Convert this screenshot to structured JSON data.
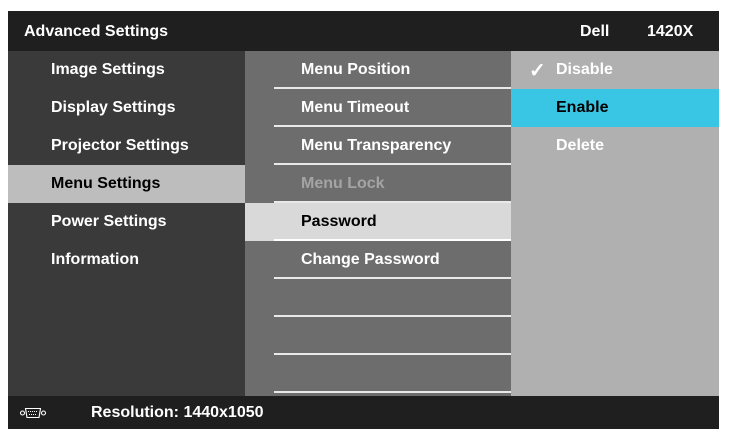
{
  "header": {
    "title": "Advanced Settings",
    "brand": "Dell",
    "model": "1420X"
  },
  "main_menu": {
    "items": [
      {
        "label": "Image Settings"
      },
      {
        "label": "Display Settings"
      },
      {
        "label": "Projector Settings"
      },
      {
        "label": "Menu Settings",
        "selected": true
      },
      {
        "label": "Power Settings"
      },
      {
        "label": "Information"
      }
    ]
  },
  "submenu": {
    "items": [
      {
        "label": "Menu Position"
      },
      {
        "label": "Menu Timeout"
      },
      {
        "label": "Menu Transparency"
      },
      {
        "label": "Menu Lock",
        "disabled": true
      },
      {
        "label": "Password",
        "selected": true
      },
      {
        "label": "Change Password"
      }
    ]
  },
  "options": {
    "items": [
      {
        "label": "Disable",
        "checked": true
      },
      {
        "label": "Enable",
        "highlighted": true
      },
      {
        "label": "Delete"
      }
    ]
  },
  "status": {
    "icon": "vga-connector-icon",
    "resolution": "Resolution: 1440x1050"
  },
  "colors": {
    "highlight": "#38c6e4",
    "background": "#1f1f1f",
    "panel_mid": "#6d6d6d",
    "panel_right": "#b0b0b0"
  }
}
